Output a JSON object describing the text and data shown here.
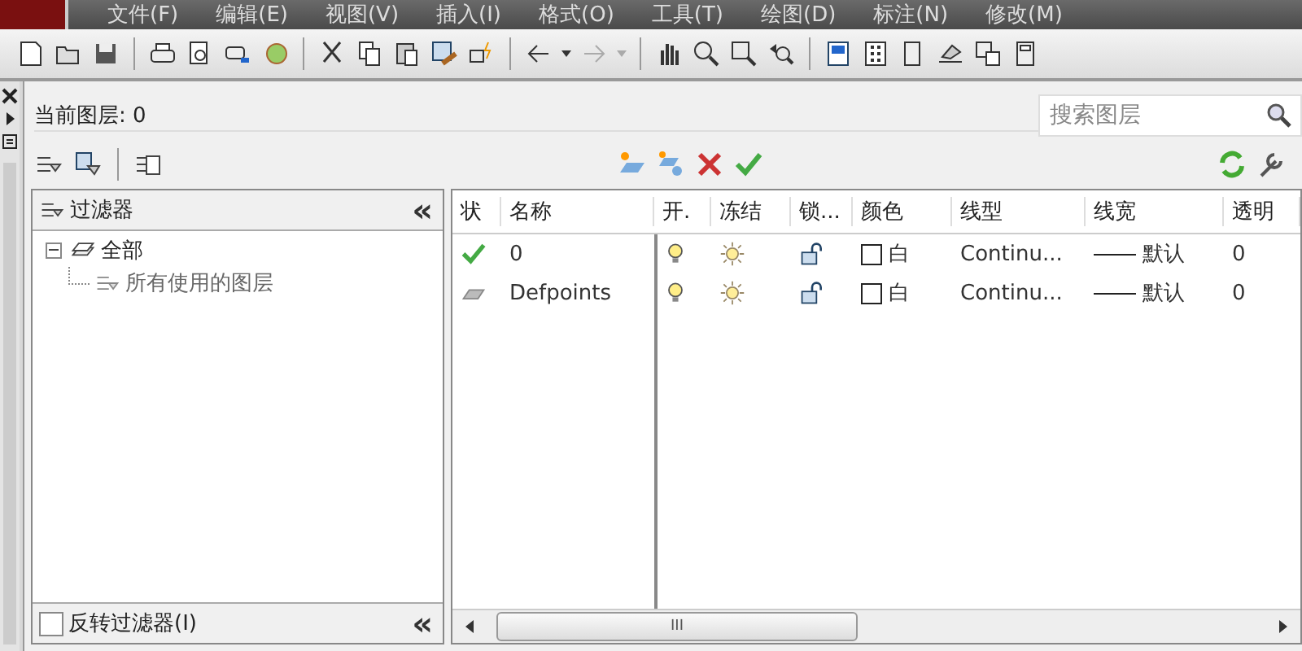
{
  "menu": [
    "文件(F)",
    "编辑(E)",
    "视图(V)",
    "插入(I)",
    "格式(O)",
    "工具(T)",
    "绘图(D)",
    "标注(N)",
    "修改(M)"
  ],
  "current_layer": "当前图层: 0",
  "search": {
    "placeholder": "搜索图层"
  },
  "filters": {
    "title": "过滤器",
    "collapse": "«",
    "tree": [
      {
        "label": "全部",
        "expanded": true,
        "children": [
          {
            "label": "所有使用的图层"
          }
        ]
      }
    ],
    "invert": {
      "label": "反转过滤器(I)",
      "checked": false
    },
    "collapse_bottom": "«"
  },
  "table": {
    "columns": [
      "状",
      "名称",
      "开.",
      "冻结",
      "锁...",
      "颜色",
      "线型",
      "线宽",
      "透明"
    ],
    "rows": [
      {
        "current": true,
        "name": "0",
        "on": true,
        "frozen": false,
        "locked": false,
        "color": "#ffffff",
        "color_name": "白",
        "linetype": "Continu...",
        "lineweight": "默认",
        "transparency": "0"
      },
      {
        "current": false,
        "name": "Defpoints",
        "on": true,
        "frozen": false,
        "locked": false,
        "color": "#ffffff",
        "color_name": "白",
        "linetype": "Continu...",
        "lineweight": "默认",
        "transparency": "0"
      }
    ]
  },
  "scroll_grip": "III"
}
